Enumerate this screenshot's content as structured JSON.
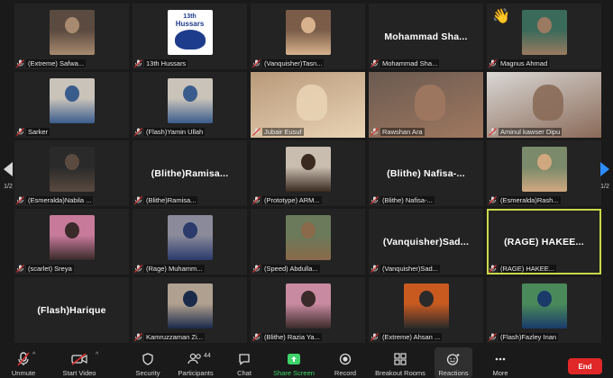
{
  "tiles": [
    {
      "name": "(Extreme) Safwa...",
      "type": "photo",
      "bg": "#5b4a3f",
      "fg": "#a88a70"
    },
    {
      "name": "13th Hussars",
      "type": "logo",
      "bg": "#ffffff",
      "fg": "#1e3c8c"
    },
    {
      "name": "(Vanquisher)Tasn...",
      "type": "photo",
      "bg": "#7a5c48",
      "fg": "#d7b28c"
    },
    {
      "name": "Mohammad Sha...",
      "type": "text",
      "display": "Mohammad  Sha..."
    },
    {
      "name": "Magnus Ahmad",
      "type": "photo",
      "bg": "#3a6a5a",
      "fg": "#9a7a60",
      "emoji": "👋"
    },
    {
      "name": "Sarker",
      "type": "photo",
      "bg": "#c9c3ba",
      "fg": "#3a5c8c"
    },
    {
      "name": "(Flash)Yamin Ullah",
      "type": "photo",
      "bg": "#c9c3ba",
      "fg": "#3a5c8c"
    },
    {
      "name": "Jubair Eusuf",
      "type": "video",
      "bg": "#b89a7a",
      "fg": "#e9d3b5"
    },
    {
      "name": "Rawshan Ara",
      "type": "video",
      "bg": "#6a5a50",
      "fg": "#a07860"
    },
    {
      "name": "Aminul kawser Dipu",
      "type": "video",
      "bg": "#d9d7d4",
      "fg": "#8a6a58"
    },
    {
      "name": "(Esmeralda)Nabila ...",
      "type": "photo",
      "bg": "#2a2a2a",
      "fg": "#5a4a40"
    },
    {
      "name": "(Blithe)Ramisa...",
      "type": "text",
      "display": "(Blithe)Ramisa..."
    },
    {
      "name": "(Prototype) ARM...",
      "type": "photo",
      "bg": "#c9bdb0",
      "fg": "#3a2a20"
    },
    {
      "name": "(Blithe) Nafisa-...",
      "type": "text",
      "display": "(Blithe)  Nafisa-..."
    },
    {
      "name": "(Esmeralda)Rash...",
      "type": "photo",
      "bg": "#7a8a6a",
      "fg": "#d0a880"
    },
    {
      "name": "(scarlet)  Sreya",
      "type": "photo",
      "bg": "#c77a9a",
      "fg": "#3a2a2a"
    },
    {
      "name": "(Rage) Muhamm...",
      "type": "photo",
      "bg": "#8a8a9a",
      "fg": "#2a3a6a"
    },
    {
      "name": "(Speed) Abdulla...",
      "type": "photo",
      "bg": "#6a7a5a",
      "fg": "#8a6a4a"
    },
    {
      "name": "(Vanquisher)Sad...",
      "type": "text",
      "display": "(Vanquisher)Sad..."
    },
    {
      "name": "(RAGE) HAKEE...",
      "type": "text",
      "display": "(RAGE)  HAKEE...",
      "active": true
    },
    {
      "name": "(Flash)Harique",
      "type": "text",
      "display": "(Flash)Harique",
      "noplate": true
    },
    {
      "name": "Kamruzzaman Zi...",
      "type": "photo",
      "bg": "#b0a090",
      "fg": "#1a2a4a"
    },
    {
      "name": "(Blithe) Razia Ya...",
      "type": "photo",
      "bg": "#c88aa0",
      "fg": "#3a2a2a"
    },
    {
      "name": "(Extreme)  Ahsan ...",
      "type": "photo",
      "bg": "#c85a20",
      "fg": "#2a2a2a"
    },
    {
      "name": "(Flash)Fazley Inan",
      "type": "photo",
      "bg": "#4a8a5a",
      "fg": "#1a3a6a"
    }
  ],
  "pager": {
    "left": "1/2",
    "right": "1/2"
  },
  "toolbar": {
    "unmute": "Unmute",
    "start_video": "Start Video",
    "security": "Security",
    "participants": "Participants",
    "participants_count": "44",
    "chat": "Chat",
    "share_screen": "Share Screen",
    "record": "Record",
    "breakout_rooms": "Breakout Rooms",
    "reactions": "Reactions",
    "more": "More",
    "end": "End"
  },
  "logo_text": {
    "top": "13th",
    "main": "Hussars"
  },
  "colors": {
    "share_green": "#3fd36b",
    "end_red": "#e02828",
    "active_speaker": "#c9d94a",
    "pager_blue": "#2d8cff"
  }
}
